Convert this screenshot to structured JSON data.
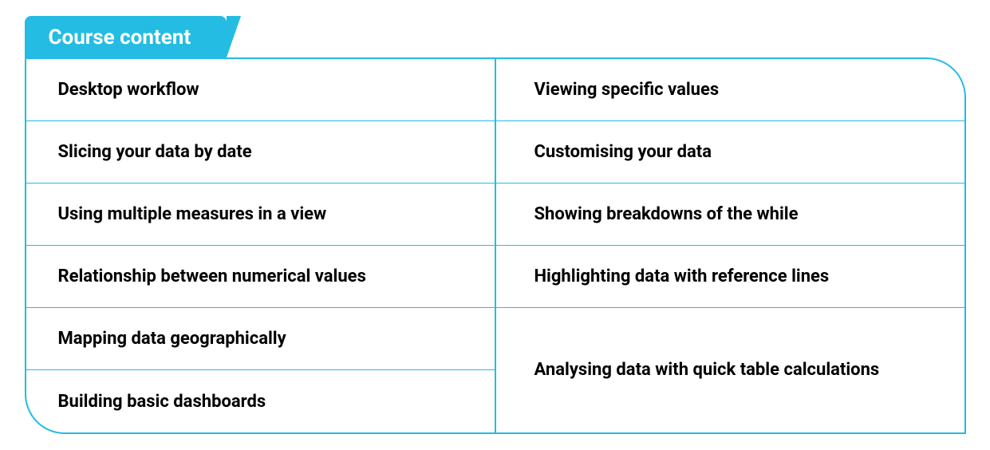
{
  "header": {
    "title": "Course content"
  },
  "columns": {
    "left": [
      "Desktop workflow",
      "Slicing your data by date",
      "Using multiple measures in a view",
      "Relationship between numerical values",
      "Mapping data geographically",
      "Building basic dashboards"
    ],
    "right": [
      "Viewing specific values",
      "Customising your data",
      "Showing breakdowns of the while",
      "Highlighting data with reference lines",
      "Analysing data with quick table calculations"
    ]
  }
}
